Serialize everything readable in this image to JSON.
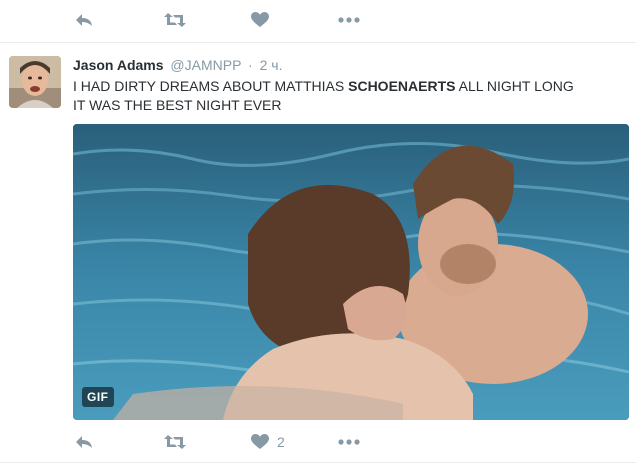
{
  "top_actions": {
    "reply_icon": "reply-icon",
    "retweet_icon": "retweet-icon",
    "like_icon": "heart-icon",
    "more_icon": "more-dots-icon"
  },
  "tweet": {
    "fullname": "Jason Adams",
    "username": "@JAMNPP",
    "separator": "·",
    "time": "2 ч.",
    "text_line1_pre": "I HAD DIRTY DREAMS ABOUT MATTHIAS ",
    "text_line1_bold": "SCHOENAERTS",
    "text_line1_post": " ALL NIGHT LONG",
    "text_line2": "IT WAS THE BEST NIGHT EVER",
    "media_badge": "GIF",
    "like_count": "2"
  },
  "colors": {
    "icon_gray": "#8899a6",
    "text": "#292f33",
    "border": "#e6ecf0",
    "pool_water": "#2f6f8d"
  }
}
